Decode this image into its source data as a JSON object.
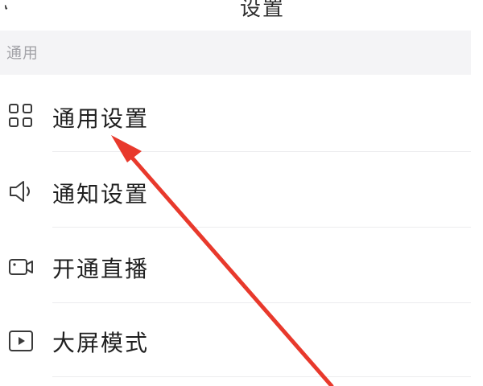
{
  "nav": {
    "back_icon": "back-arrow-icon",
    "title": "设置"
  },
  "section": {
    "label": "通用"
  },
  "menu": {
    "items": [
      {
        "label": "通用设置",
        "icon": "grid-four-squares-icon"
      },
      {
        "label": "通知设置",
        "icon": "speaker-icon"
      },
      {
        "label": "开通直播",
        "icon": "video-camera-icon"
      },
      {
        "label": "大屏模式",
        "icon": "play-screen-icon"
      }
    ]
  },
  "annotation": {
    "arrow_color": "#e8392c"
  }
}
